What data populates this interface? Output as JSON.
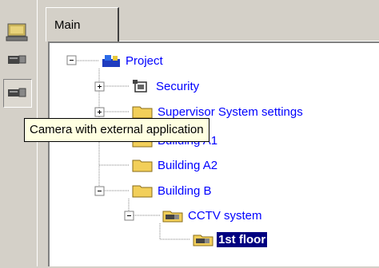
{
  "tabs": [
    {
      "label": "Main"
    }
  ],
  "tooltip": "Camera with external application",
  "tree": {
    "project": "Project",
    "security": "Security",
    "supervisor": "Supervisor System settings",
    "building_a1": "Building A1",
    "building_a2": "Building A2",
    "building_b": "Building B",
    "cctv": "CCTV system",
    "first_floor": "1st floor"
  },
  "colors": {
    "link": "#0000ff",
    "selection_bg": "#000080",
    "selection_fg": "#ffffff",
    "tooltip_bg": "#ffffe1",
    "chrome": "#d4d0c8",
    "folder": "#f2cf5a"
  },
  "icons": {
    "rail": [
      "monitor-icon",
      "camera-icon",
      "camera-icon"
    ],
    "project": "project-icon",
    "security": "security-icon",
    "folders": "folder-icon",
    "cctv": "camera-folder-icon"
  }
}
